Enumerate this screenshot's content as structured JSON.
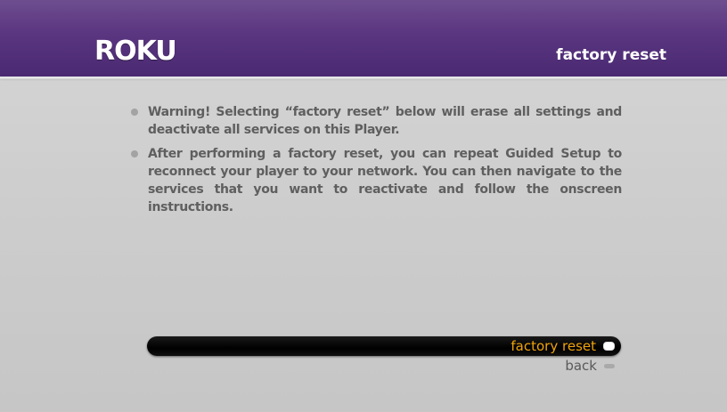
{
  "header": {
    "logo": "ROKU",
    "title": "factory reset"
  },
  "content": {
    "bullets": [
      "Warning! Selecting “factory reset” below will erase all settings and deactivate all services on this Player.",
      "After performing a factory reset, you can repeat Guided Setup to reconnect your player to your network. You can then navigate to the services that you want to reactivate and follow the onscreen instructions."
    ]
  },
  "menu": {
    "items": [
      {
        "label": "factory reset",
        "selected": true
      },
      {
        "label": "back",
        "selected": false
      }
    ]
  },
  "colors": {
    "header": "#5a3580",
    "background": "#cdcdcd",
    "selected_text": "#f0a30a",
    "body_text": "#5f5f5f"
  },
  "icons": {
    "bullet": "bullet-dot-icon",
    "menu_indicator": "pill-indicator-icon"
  }
}
